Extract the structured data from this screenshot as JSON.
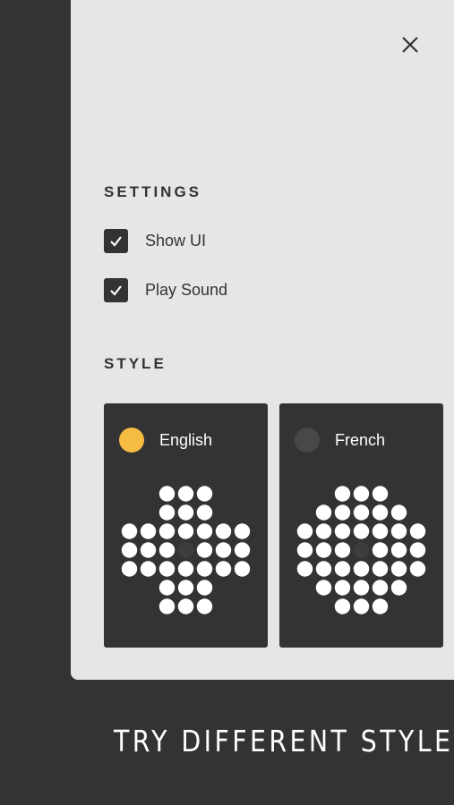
{
  "colors": {
    "background": "#333333",
    "panel": "#e6e6e6",
    "accent": "#f6bb42",
    "peg": "#ffffff",
    "empty_hole": "#3d3d3d",
    "radio_off": "#484848"
  },
  "close_icon": "close-icon",
  "settings": {
    "title": "SETTINGS",
    "options": [
      {
        "label": "Show UI",
        "checked": true
      },
      {
        "label": "Play Sound",
        "checked": true
      }
    ]
  },
  "style": {
    "title": "STYLE",
    "choices": [
      {
        "label": "English",
        "selected": true
      },
      {
        "label": "French",
        "selected": false
      }
    ]
  },
  "tagline": "TRY DIFFERENT STYLES"
}
